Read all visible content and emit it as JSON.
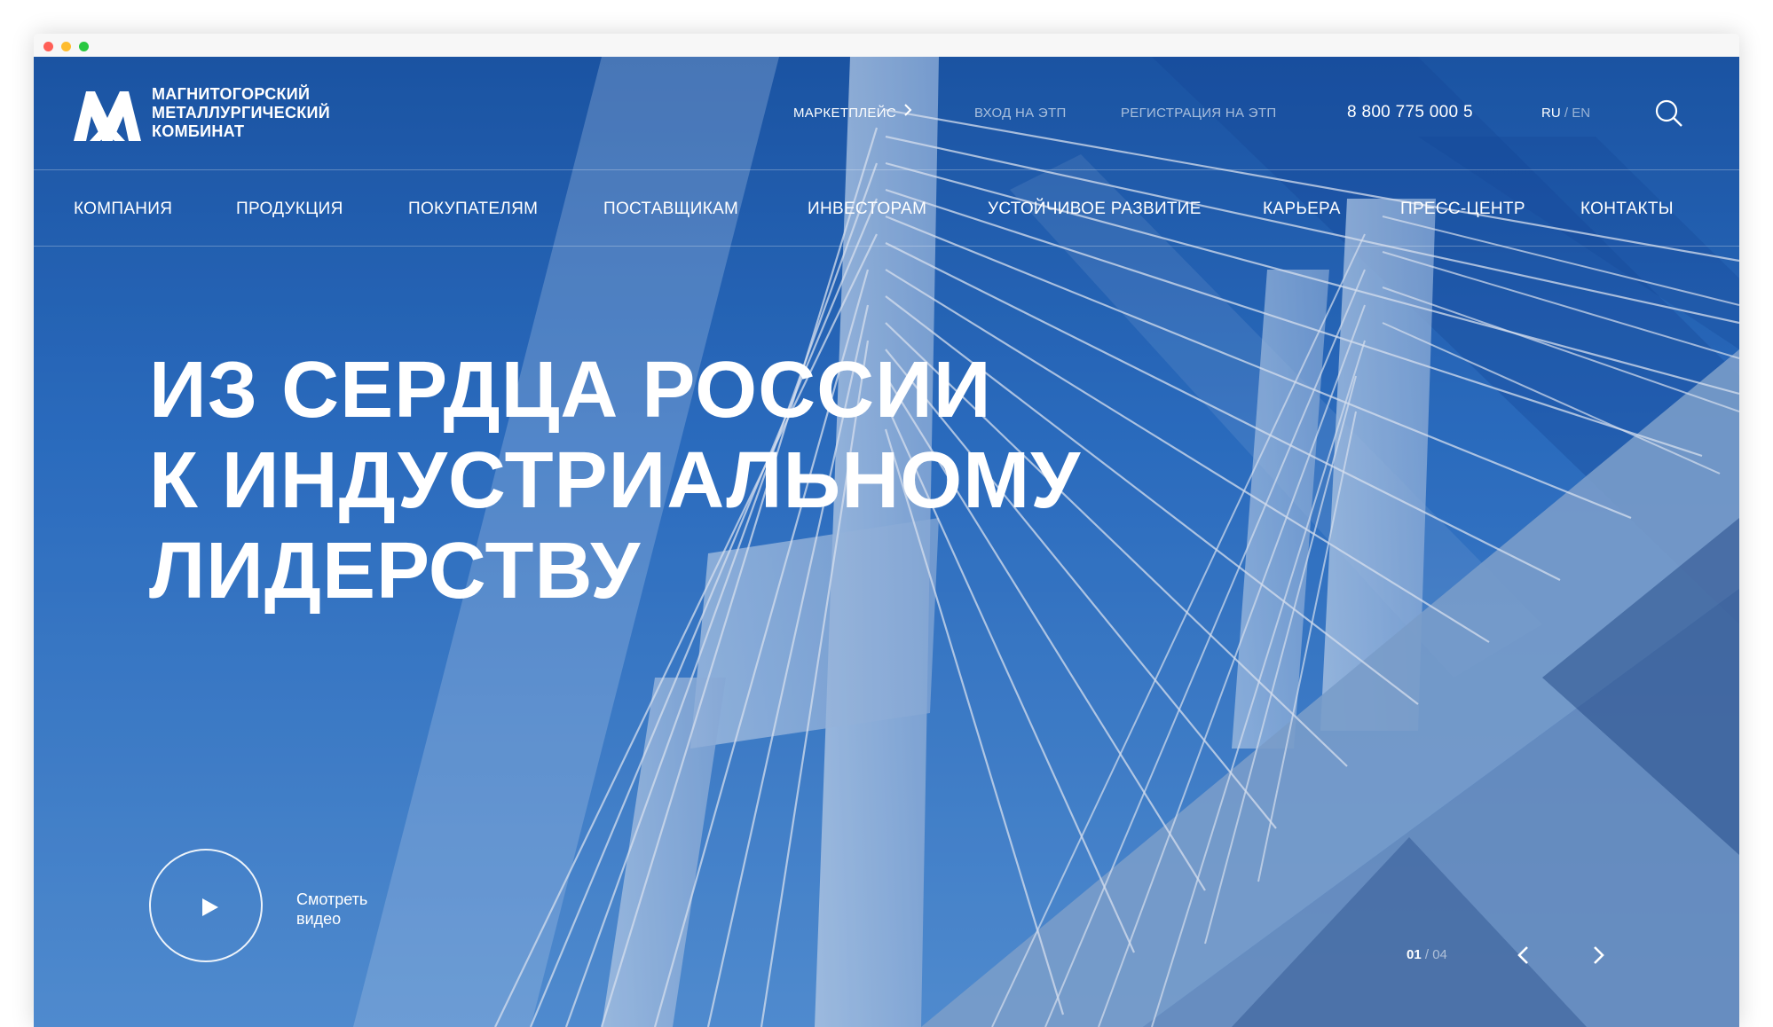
{
  "window": {
    "controls": [
      "close",
      "minimize",
      "maximize"
    ],
    "colors": {
      "close": "#ff5f57",
      "minimize": "#febc2e",
      "maximize": "#28c840"
    }
  },
  "brand": {
    "logo_icon": "mmk-logo-icon",
    "lines": [
      "МАГНИТОГОРСКИЙ",
      "МЕТАЛЛУРГИЧЕСКИЙ",
      "КОМБИНАТ"
    ]
  },
  "topbar": {
    "marketplace": "МАРКЕТПЛЕЙС",
    "etp_login": "ВХОД НА ЭТП",
    "etp_register": "РЕГИСТРАЦИЯ НА ЭТП",
    "phone": "8 800 775 000 5",
    "lang_active": "RU",
    "lang_sep": "/",
    "lang_inactive": "EN",
    "search_icon": "search-icon"
  },
  "nav": [
    "КОМПАНИЯ",
    "ПРОДУКЦИЯ",
    "ПОКУПАТЕЛЯМ",
    "ПОСТАВЩИКАМ",
    "ИНВЕСТОРАМ",
    "УСТОЙЧИВОЕ РАЗВИТИЕ",
    "КАРЬЕРА",
    "ПРЕСС-ЦЕНТР",
    "КОНТАКТЫ"
  ],
  "hero": {
    "headline": [
      "ИЗ СЕРДЦА РОССИИ",
      "К ИНДУСТРИАЛЬНОМУ",
      "ЛИДЕРСТВУ"
    ],
    "video_label": "Смотреть видео",
    "play_icon": "play-icon"
  },
  "slider": {
    "current": "01",
    "sep": "/",
    "total": "04",
    "prev_icon": "chevron-left-icon",
    "next_icon": "chevron-right-icon"
  },
  "colors": {
    "primary_blue": "#1e5aa8",
    "sky_blue": "#4e8fd6",
    "text_white": "#ffffff"
  }
}
